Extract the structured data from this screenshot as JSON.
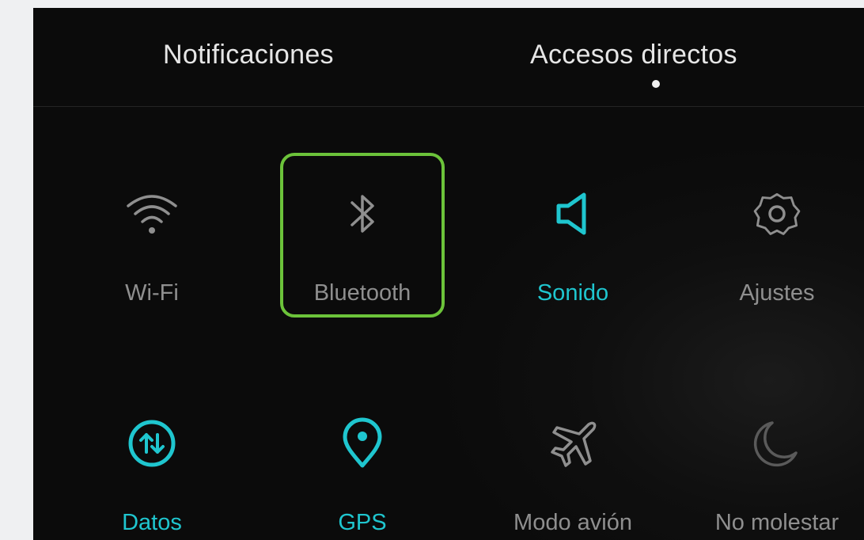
{
  "tabs": [
    {
      "label": "Notificaciones"
    },
    {
      "label": "Accesos directos"
    }
  ],
  "colors": {
    "active": "#1fc6cf",
    "inactive": "#8f8f8f",
    "highlight": "#6cc33a",
    "background": "#0f0f0f"
  },
  "tiles": [
    {
      "label": "Wi-Fi",
      "icon": "wifi-icon",
      "active": false
    },
    {
      "label": "Bluetooth",
      "icon": "bluetooth-icon",
      "active": false,
      "highlighted": true
    },
    {
      "label": "Sonido",
      "icon": "sound-icon",
      "active": true
    },
    {
      "label": "Ajustes",
      "icon": "gear-icon",
      "active": false
    },
    {
      "label": "Datos",
      "icon": "mobile-data-icon",
      "active": true
    },
    {
      "label": "GPS",
      "icon": "location-pin-icon",
      "active": true
    },
    {
      "label": "Modo avión",
      "icon": "airplane-icon",
      "active": false
    },
    {
      "label": "No molestar",
      "icon": "moon-icon",
      "active": false
    }
  ]
}
